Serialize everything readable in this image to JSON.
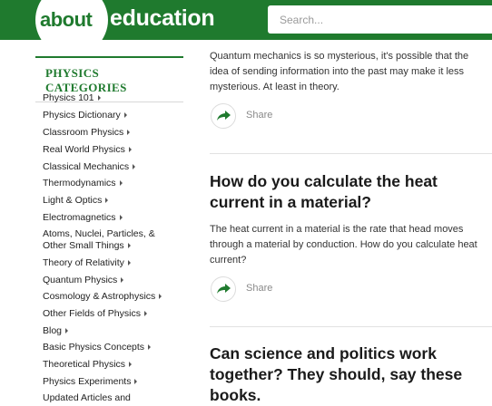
{
  "header": {
    "logo_about": "about",
    "logo_section": "education",
    "search_placeholder": "Search..."
  },
  "sidebar": {
    "title": "PHYSICS CATEGORIES",
    "items": [
      {
        "label": "Physics 101"
      },
      {
        "label": "Physics Dictionary"
      },
      {
        "label": "Classroom Physics"
      },
      {
        "label": "Real World Physics"
      },
      {
        "label": "Classical Mechanics"
      },
      {
        "label": "Thermodynamics"
      },
      {
        "label": "Light & Optics"
      },
      {
        "label": "Electromagnetics"
      },
      {
        "label_line1": "Atoms, Nuclei, Particles, &",
        "label_line2": "Other Small Things"
      },
      {
        "label": "Theory of Relativity"
      },
      {
        "label": "Quantum Physics"
      },
      {
        "label": "Cosmology & Astrophysics"
      },
      {
        "label": "Other Fields of Physics"
      },
      {
        "label": "Blog"
      },
      {
        "label": "Basic Physics Concepts"
      },
      {
        "label": "Theoretical Physics"
      },
      {
        "label": "Physics Experiments"
      },
      {
        "label": "Updated Articles and"
      }
    ]
  },
  "articles": [
    {
      "description": "Quantum mechanics is so mysterious, it's possible that the idea of sending information into the past may make it less mysterious. At least in theory.",
      "share_label": "Share"
    },
    {
      "title": "How do you calculate the heat current in a material?",
      "description": "The heat current in a material is the rate that head moves through a material by conduction. How do you calculate heat current?",
      "share_label": "Share"
    },
    {
      "title": "Can science and politics work together? They should, say these books."
    }
  ],
  "colors": {
    "brand_green": "#1f7a2e",
    "share_icon": "#1f7a2e"
  }
}
